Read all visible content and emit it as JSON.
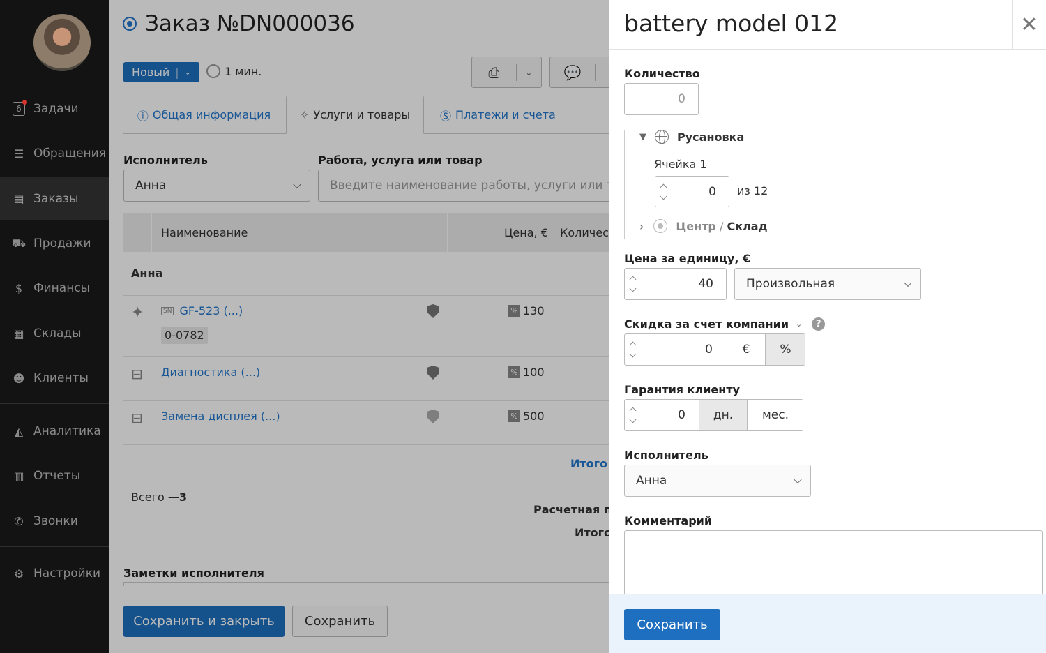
{
  "sidebar": {
    "items": [
      {
        "label": "Задачи",
        "badge": "6",
        "icon": "tasks-icon"
      },
      {
        "label": "Обращения",
        "icon": "inquiries-icon"
      },
      {
        "label": "Заказы",
        "icon": "orders-icon",
        "active": true
      },
      {
        "label": "Продажи",
        "icon": "cart-icon"
      },
      {
        "label": "Финансы",
        "icon": "dollar-icon"
      },
      {
        "label": "Склады",
        "icon": "warehouse-icon"
      },
      {
        "label": "Клиенты",
        "icon": "clients-icon"
      },
      {
        "label": "Аналитика",
        "icon": "analytics-icon"
      },
      {
        "label": "Отчеты",
        "icon": "reports-icon"
      },
      {
        "label": "Звонки",
        "icon": "phone-icon"
      },
      {
        "label": "Настройки",
        "icon": "gear-icon"
      }
    ]
  },
  "order": {
    "title": "Заказ №DN000036",
    "status": "Новый",
    "time": "1 мин."
  },
  "tabs": [
    "Общая информация",
    "Услуги и товары",
    "Платежи и счета"
  ],
  "filters": {
    "executor_label": "Исполнитель",
    "executor_value": "Анна",
    "work_label": "Работа, услуга или товар",
    "work_placeholder": "Введите наименование работы, услуги или товара"
  },
  "table": {
    "headers": [
      "Наименование",
      "Цена, €",
      "Количес."
    ],
    "group": "Анна",
    "rows": [
      {
        "sn_label": "SN",
        "name": "GF-523 (...)",
        "serial": "0-0782",
        "price": "130"
      },
      {
        "name": "Диагностика (...)",
        "price": "100"
      },
      {
        "name": "Замена дисплея (...)",
        "price": "500"
      }
    ],
    "total_link": "Итого",
    "count_prefix": "Всего — ",
    "count": "3",
    "calc_label": "Расчетная пр",
    "total_label": "Итого"
  },
  "notes_label": "Заметки исполнителя",
  "buttons": {
    "save_close": "Сохранить и закрыть",
    "save": "Сохранить"
  },
  "panel": {
    "title": "battery model 012",
    "quantity_label": "Количество",
    "quantity_value": "0",
    "location": "Русановка",
    "cell_label": "Ячейка 1",
    "cell_value": "0",
    "cell_of": "из 12",
    "center": "Центр",
    "center_sep": " / ",
    "warehouse": "Склад",
    "price_label": "Цена за единицу, €",
    "price_value": "40",
    "price_type": "Произвольная",
    "discount_label": "Скидка за счет компании",
    "discount_value": "0",
    "discount_units": [
      "€",
      "%"
    ],
    "warranty_label": "Гарантия клиенту",
    "warranty_value": "0",
    "warranty_units": [
      "дн.",
      "мес."
    ],
    "executor_label": "Исполнитель",
    "executor_value": "Анна",
    "comment_label": "Комментарий",
    "save": "Сохранить"
  },
  "colors": {
    "accent": "#1e6fbf",
    "link": "#2277cc",
    "sidebar": "#131313"
  }
}
